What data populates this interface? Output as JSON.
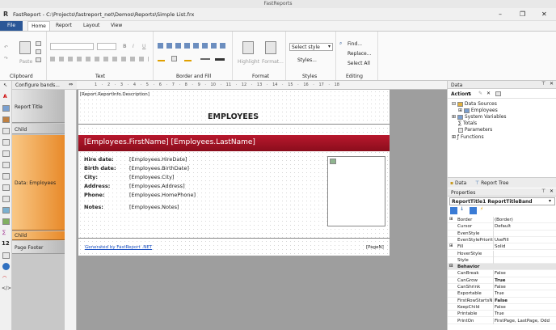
{
  "app": {
    "top_caption": "FastReports",
    "title": "FastReport - C:\\Projects\\fastreport_net\\Demos\\Reports\\Simple List.frx",
    "logo": "R"
  },
  "window_controls": {
    "min": "–",
    "max": "❐",
    "close": "✕"
  },
  "ribbon": {
    "tabs": [
      "File",
      "Home",
      "Report",
      "Layout",
      "View"
    ],
    "groups": {
      "clipboard": "Clipboard",
      "text": "Text",
      "border": "Border and Fill",
      "format": "Format",
      "styles": "Styles",
      "editing": "Editing"
    },
    "paste": "Paste",
    "font_bold": "B",
    "font_italic": "I",
    "font_underline": "U",
    "highlight": "Highlight",
    "format_btn": "Format...",
    "select_style": "Select style",
    "styles_btn": "Styles...",
    "find": "Find...",
    "replace": "Replace...",
    "select_all": "Select All"
  },
  "bands_toolbar": {
    "configure": "Configure bands..."
  },
  "bands": {
    "report_title": "Report Title",
    "child1": "Child",
    "data": "Data: Employees",
    "child2": "Child",
    "page_footer": "Page Footer"
  },
  "report": {
    "description": "[Report.ReportInfo.Description]",
    "heading": "EMPLOYEES",
    "name_line": "[Employees.FirstName] [Employees.LastName]",
    "fields": [
      {
        "label": "Hire date:",
        "value": "[Employees.HireDate]"
      },
      {
        "label": "Birth date:",
        "value": "[Employees.BirthDate]"
      },
      {
        "label": "City:",
        "value": "[Employees.City]"
      },
      {
        "label": "Address:",
        "value": "[Employees.Address]"
      },
      {
        "label": "Phone:",
        "value": "[Employees.HomePhone]"
      }
    ],
    "notes_label": "Notes:",
    "notes_value": "[Employees.Notes]",
    "footer_link": "Generated by FastReport .NET",
    "footer_page": "[PageN]"
  },
  "ruler": "1 · 2 · 3 · 4 · 5 · 6 · 7 · 8 · 9 · 10 · 11 · 12 · 13 · 14 · 15 · 16 · 17 · 18",
  "data_panel": {
    "title": "Data",
    "actions": "Actions",
    "tree": [
      "Data Sources",
      "Employees",
      "System Variables",
      "Totals",
      "Parameters",
      "Functions"
    ],
    "tab_data": "Data",
    "tab_report_tree": "Report Tree"
  },
  "properties": {
    "title": "Properties",
    "selected": "ReportTitle1  ReportTitleBand",
    "rows": [
      {
        "name": "Border",
        "value": "(Border)",
        "plus": true
      },
      {
        "name": "Cursor",
        "value": "Default"
      },
      {
        "name": "EvenStyle",
        "value": ""
      },
      {
        "name": "EvenStylePriority",
        "value": "UseFill"
      },
      {
        "name": "Fill",
        "value": "Solid",
        "plus": true
      },
      {
        "name": "HoverStyle",
        "value": ""
      },
      {
        "name": "Style",
        "value": ""
      },
      {
        "name": "Behavior",
        "value": "",
        "section": true
      },
      {
        "name": "CanBreak",
        "value": "False"
      },
      {
        "name": "CanGrow",
        "value": "True",
        "bold": true
      },
      {
        "name": "CanShrink",
        "value": "False"
      },
      {
        "name": "Exportable",
        "value": "True"
      },
      {
        "name": "FirstRowStartsN",
        "value": "False",
        "bold": true
      },
      {
        "name": "KeepChild",
        "value": "False"
      },
      {
        "name": "Printable",
        "value": "True"
      },
      {
        "name": "PrintOn",
        "value": "FirstPage, LastPage, Odd"
      }
    ]
  }
}
